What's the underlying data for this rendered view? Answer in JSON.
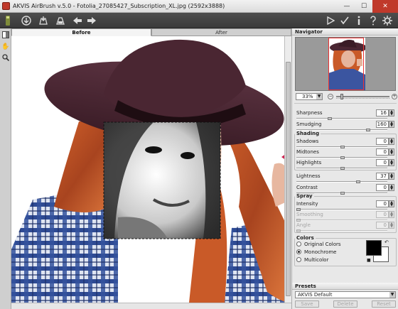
{
  "window": {
    "title": "AKVIS AirBrush v.5.0 - Fotolia_27085427_Subscription_XL.jpg (2592x3888)",
    "minimize": "—",
    "maximize": "☐",
    "close": "✕"
  },
  "toolbar": {
    "icons": [
      "open-icon",
      "save-icon",
      "print-icon",
      "undo-icon",
      "redo-icon",
      "run-icon",
      "apply-icon",
      "info-icon",
      "help-icon",
      "settings-icon"
    ]
  },
  "tabs": {
    "before": "Before",
    "after": "After"
  },
  "navigator": {
    "title": "Navigator",
    "zoom": "33%",
    "zoom_level_percent": 33
  },
  "params": {
    "sharpness": {
      "label": "Sharpness",
      "value": "16"
    },
    "smudging": {
      "label": "Smudging",
      "value": "160"
    },
    "shading": {
      "title": "Shading",
      "shadows": {
        "label": "Shadows",
        "value": "0"
      },
      "midtones": {
        "label": "Midtones",
        "value": "0"
      },
      "highlights": {
        "label": "Highlights",
        "value": "0"
      }
    },
    "lightness": {
      "label": "Lightness",
      "value": "37"
    },
    "contrast": {
      "label": "Contrast",
      "value": "0"
    },
    "spray": {
      "title": "Spray",
      "intensity": {
        "label": "Intensity",
        "value": "0"
      },
      "smoothing": {
        "label": "Smoothing",
        "value": "0"
      },
      "angle": {
        "label": "Angle",
        "value": "0"
      }
    },
    "colors": {
      "title": "Colors",
      "original": "Original Colors",
      "monochrome": "Monochrome",
      "multicolor": "Multicolor",
      "selected": "Monochrome",
      "foreground": "#000000",
      "background": "#ffffff"
    }
  },
  "presets": {
    "title": "Presets",
    "selected": "AKVIS Default",
    "save": "Save",
    "delete": "Delete",
    "reset": "Reset"
  }
}
